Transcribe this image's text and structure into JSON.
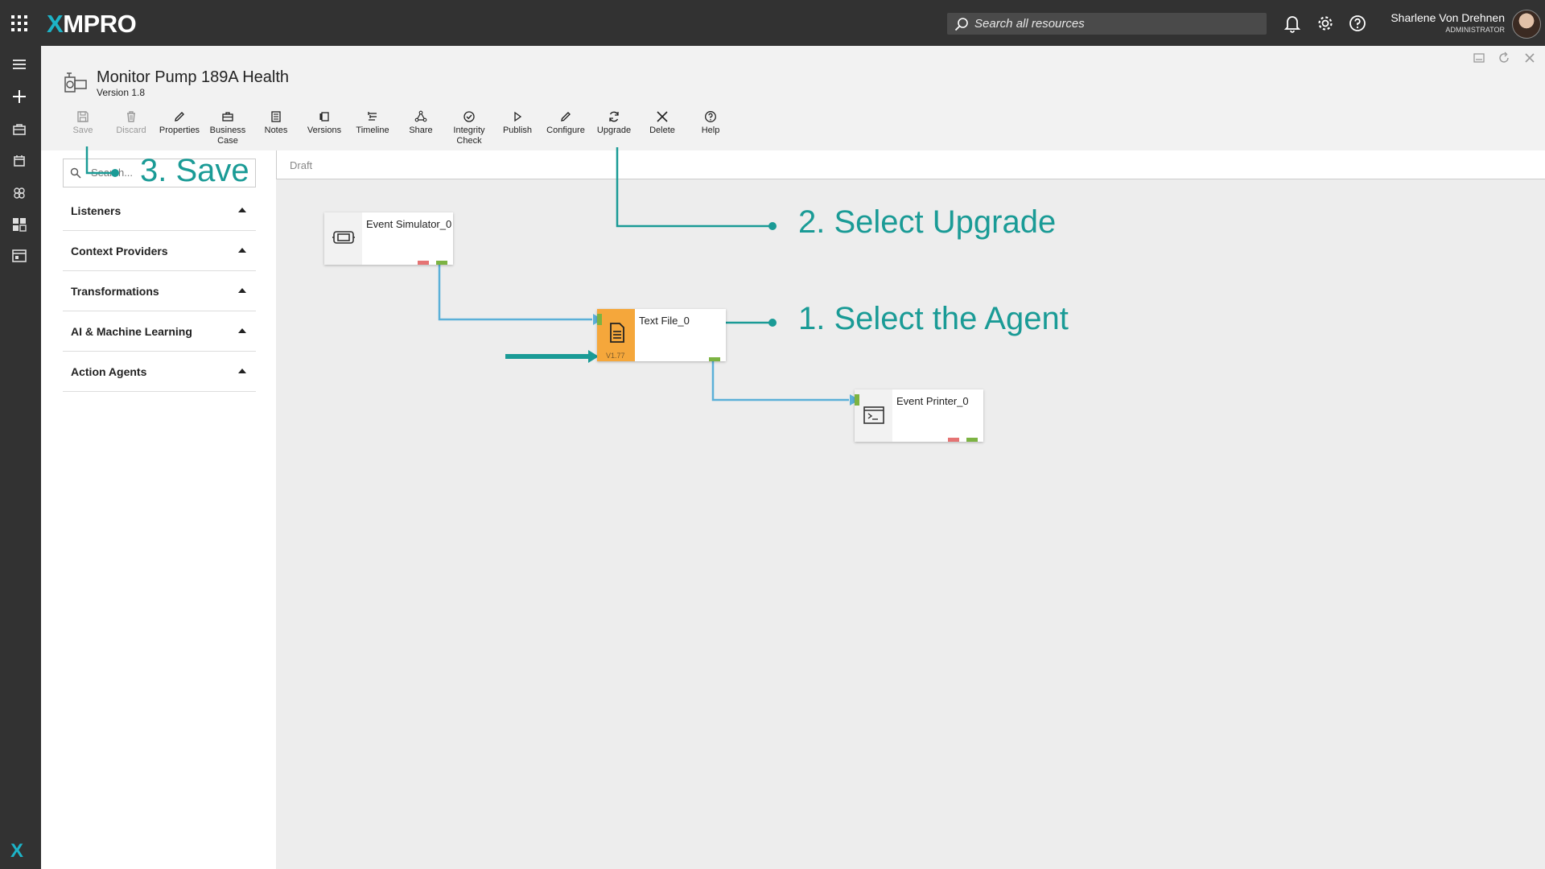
{
  "app": {
    "logo_x": "X",
    "logo_rest": "MPRO"
  },
  "header": {
    "search_placeholder": "Search all resources",
    "user_name": "Sharlene Von Drehnen",
    "user_role": "ADMINISTRATOR"
  },
  "stream": {
    "title": "Monitor Pump 189A Health",
    "version": "Version 1.8"
  },
  "toolbar": {
    "save": "Save",
    "discard": "Discard",
    "properties": "Properties",
    "business_line1": "Business",
    "business_line2": "Case",
    "notes": "Notes",
    "versions": "Versions",
    "timeline": "Timeline",
    "share": "Share",
    "integrity_line1": "Integrity",
    "integrity_line2": "Check",
    "publish": "Publish",
    "configure": "Configure",
    "upgrade": "Upgrade",
    "delete": "Delete",
    "help": "Help"
  },
  "palette": {
    "search_placeholder": "Search...",
    "categories": [
      {
        "label": "Listeners"
      },
      {
        "label": "Context Providers"
      },
      {
        "label": "Transformations"
      },
      {
        "label": "AI & Machine Learning"
      },
      {
        "label": "Action Agents"
      }
    ]
  },
  "canvas": {
    "status": "Draft",
    "agents": [
      {
        "name": "Event Simulator_0",
        "icon": "simulator-icon"
      },
      {
        "name": "Text File_0",
        "icon": "document-icon",
        "version": "V1.77",
        "selected": true
      },
      {
        "name": "Event Printer_0",
        "icon": "terminal-icon"
      }
    ]
  },
  "callouts": {
    "step1": "1. Select the Agent",
    "step2": "2. Select Upgrade",
    "step3": "3. Save"
  },
  "colors": {
    "accent": "#1a9b96",
    "connector": "#5bb0d8",
    "selected_agent": "#f5a73b",
    "port_ok": "#7cb342",
    "port_error": "#e57373",
    "topbar": "#323232"
  }
}
